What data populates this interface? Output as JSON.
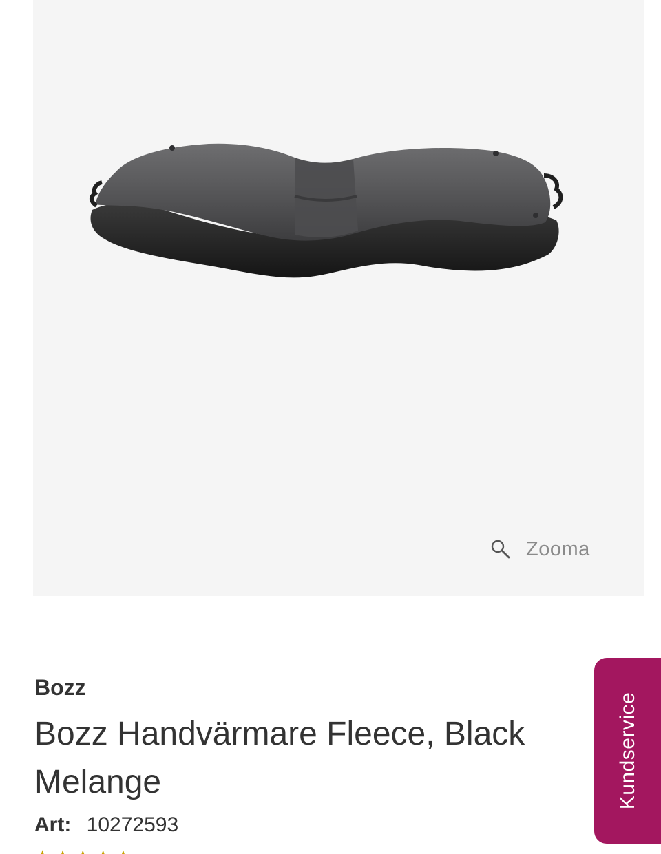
{
  "gallery": {
    "zoom_label": "Zooma",
    "zoom_icon": "magnifier-icon",
    "background_color": "#f5f5f5"
  },
  "product": {
    "brand": "Bozz",
    "title": "Bozz Handvärmare Fleece, Black Melange",
    "article_label": "Art:",
    "article_number": "10272593"
  },
  "support": {
    "tab_label": "Kundservice",
    "tab_color": "#a3175f"
  }
}
